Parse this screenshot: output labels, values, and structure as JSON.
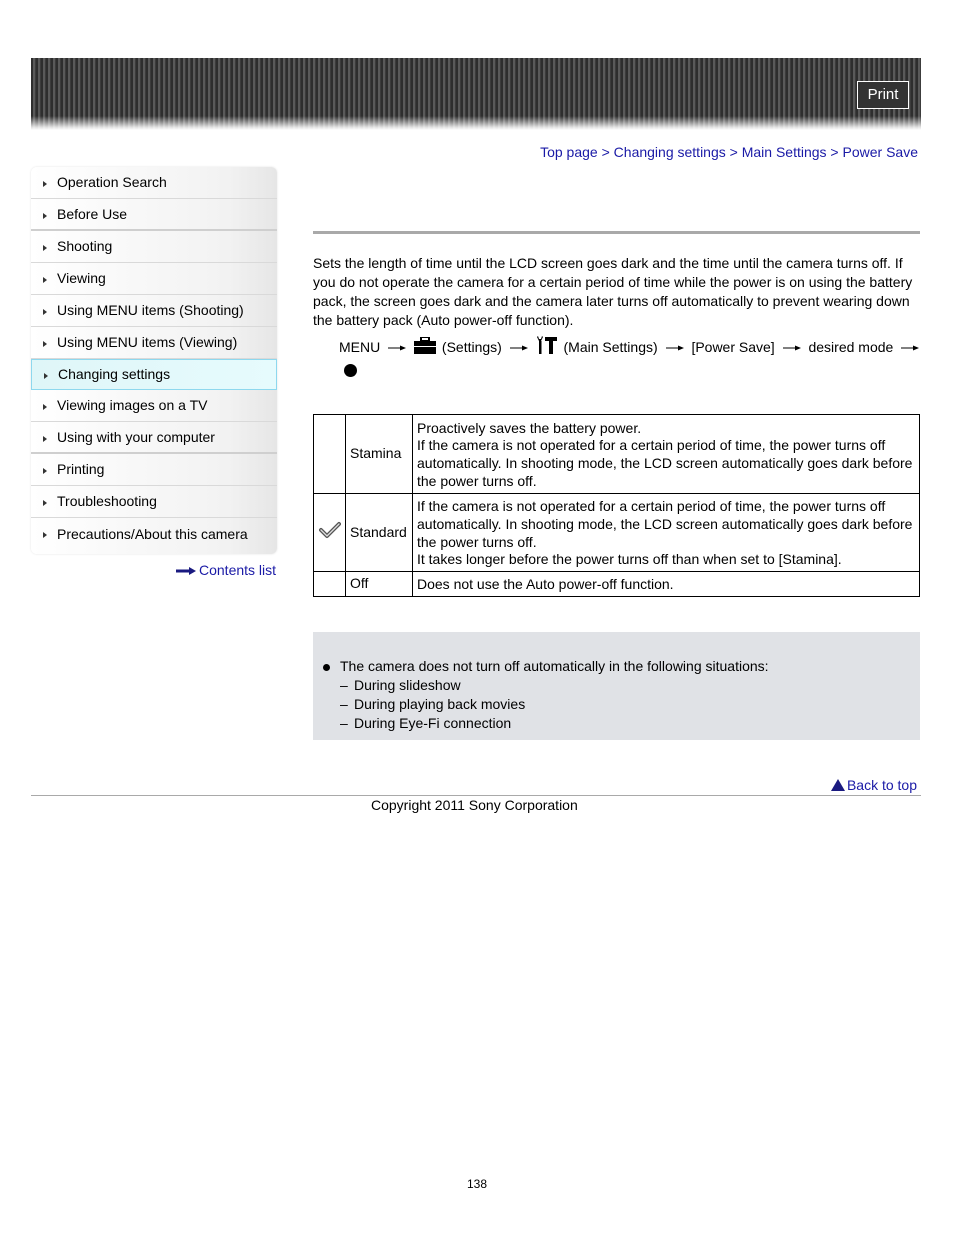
{
  "header": {
    "print_label": "Print"
  },
  "sidebar": {
    "items": [
      {
        "label": "Operation Search"
      },
      {
        "label": "Before Use"
      },
      {
        "label": "Shooting"
      },
      {
        "label": "Viewing"
      },
      {
        "label": "Using MENU items (Shooting)"
      },
      {
        "label": "Using MENU items (Viewing)"
      },
      {
        "label": "Changing settings",
        "active": true
      },
      {
        "label": "Viewing images on a TV"
      },
      {
        "label": "Using with your computer"
      },
      {
        "label": "Printing"
      },
      {
        "label": "Troubleshooting"
      },
      {
        "label": "Precautions/About this camera"
      }
    ],
    "contents_link": "Contents list"
  },
  "breadcrumb": {
    "items": [
      "Top page",
      "Changing settings",
      "Main Settings",
      "Power Save"
    ],
    "separator": " > "
  },
  "intro": "Sets the length of time until the LCD screen goes dark and the time until the camera turns off. If you do not operate the camera for a certain period of time while the power is on using the battery pack, the screen goes dark and the camera later turns off automatically to prevent wearing down the battery pack (Auto power-off function).",
  "menu_path": {
    "menu": "MENU",
    "settings": "(Settings)",
    "main_settings": "(Main Settings)",
    "power_save": "[Power Save]",
    "desired_mode": "desired mode",
    "icons": [
      "toolbox-icon",
      "wrench-hammer-icon",
      "center-button-dot-icon"
    ]
  },
  "options": [
    {
      "icon": "",
      "name": "Stamina",
      "desc": [
        "Proactively saves the battery power.",
        "If the camera is not operated for a certain period of time, the power turns off automatically. In shooting mode, the LCD screen automatically goes dark before the power turns off."
      ]
    },
    {
      "icon": "check-icon",
      "default": true,
      "name": "Standard",
      "desc": [
        "If the camera is not operated for a certain period of time, the power turns off automatically. In shooting mode, the LCD screen automatically goes dark before the power turns off.",
        "It takes longer before the power turns off than when set to [Stamina]."
      ]
    },
    {
      "icon": "",
      "name": "Off",
      "desc": [
        "Does not use the Auto power-off function."
      ]
    }
  ],
  "note": {
    "bullet": "The camera does not turn off automatically in the following situations:",
    "dash_marks": [
      "–",
      "–",
      "–"
    ],
    "subitems": [
      "During slideshow",
      "During playing back movies",
      "During Eye-Fi connection"
    ]
  },
  "footer": {
    "back_to_top": "Back to top",
    "copyright": "Copyright 2011 Sony Corporation",
    "page_number": "138"
  },
  "colors": {
    "link": "#1a1aa6",
    "active_item_bg": "#dff6f8",
    "active_item_border": "#8ed8ee",
    "note_bg": "#e0e2e6"
  }
}
